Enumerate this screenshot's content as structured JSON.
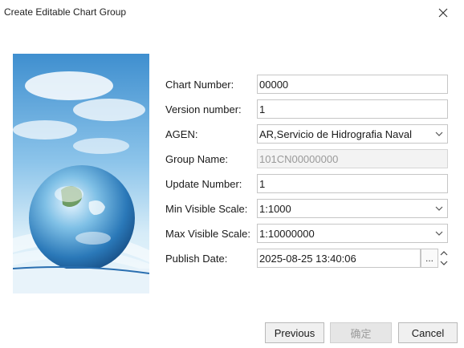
{
  "window": {
    "title": "Create Editable Chart Group"
  },
  "form": {
    "chart_number": {
      "label": "Chart Number:",
      "value": "00000"
    },
    "version_number": {
      "label": "Version number:",
      "value": "1"
    },
    "agen": {
      "label": "AGEN:",
      "value": "AR,Servicio de Hidrografia Naval"
    },
    "group_name": {
      "label": "Group Name:",
      "value": "101CN00000000"
    },
    "update_number": {
      "label": "Update Number:",
      "value": "1"
    },
    "min_visible_scale": {
      "label": "Min Visible Scale:",
      "value": "1:1000"
    },
    "max_visible_scale": {
      "label": "Max Visible Scale:",
      "value": "1:10000000"
    },
    "publish_date": {
      "label": "Publish Date:",
      "value": "2025-08-25 13:40:06",
      "browse_label": "..."
    }
  },
  "buttons": {
    "previous": "Previous",
    "ok": "确定",
    "cancel": "Cancel"
  },
  "icons": {
    "close": "close-icon",
    "chevron": "chevron-down-icon",
    "spin_up": "chevron-up-icon",
    "spin_down": "chevron-down-icon"
  },
  "colors": {
    "sky": "#4f9fd8",
    "globe": "#2e7fbf"
  }
}
